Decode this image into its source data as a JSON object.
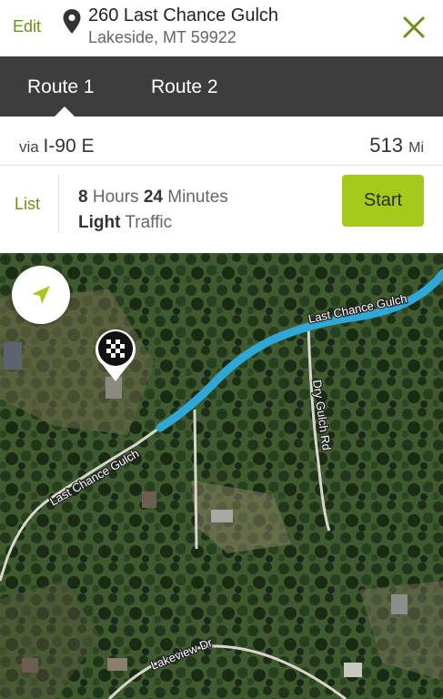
{
  "header": {
    "edit_label": "Edit",
    "address_line1": "260 Last Chance Gulch",
    "address_line2": "Lakeside, MT 59922"
  },
  "tabs": [
    {
      "label": "Route 1",
      "active": true
    },
    {
      "label": "Route 2",
      "active": false
    }
  ],
  "route_summary": {
    "via_prefix": "via",
    "via_road": "I-90 E",
    "distance": "513",
    "distance_unit": "Mi",
    "list_label": "List",
    "hours": "8",
    "hours_label": "Hours",
    "minutes": "24",
    "minutes_label": "Minutes",
    "traffic_level": "Light",
    "traffic_label": "Traffic",
    "start_label": "Start"
  },
  "map": {
    "road_labels": [
      "Last Chance Gulch",
      "Last Chance Gulch",
      "Dry Gulch Rd",
      "Lakeview Dr"
    ],
    "route_color": "#2fa8d8"
  },
  "colors": {
    "accent": "#6c8f18",
    "start_button": "#a6c91b",
    "tab_bar": "#3d3d3d"
  },
  "icons": [
    "location-pin-icon",
    "close-icon",
    "navigation-arrow-icon",
    "destination-flag-icon"
  ]
}
